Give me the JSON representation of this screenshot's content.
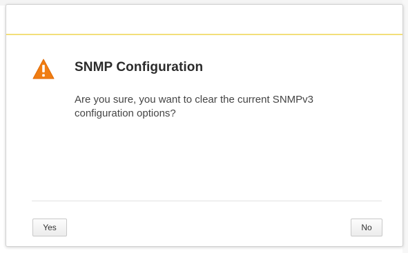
{
  "dialog": {
    "title": "SNMP Configuration",
    "message": "Are you sure, you want to clear the current SNMPv3 configuration options?",
    "icon": "warning-icon",
    "accent_color": "#f3df7a",
    "warning_color": "#f07d12"
  },
  "buttons": {
    "yes_label": "Yes",
    "no_label": "No"
  }
}
